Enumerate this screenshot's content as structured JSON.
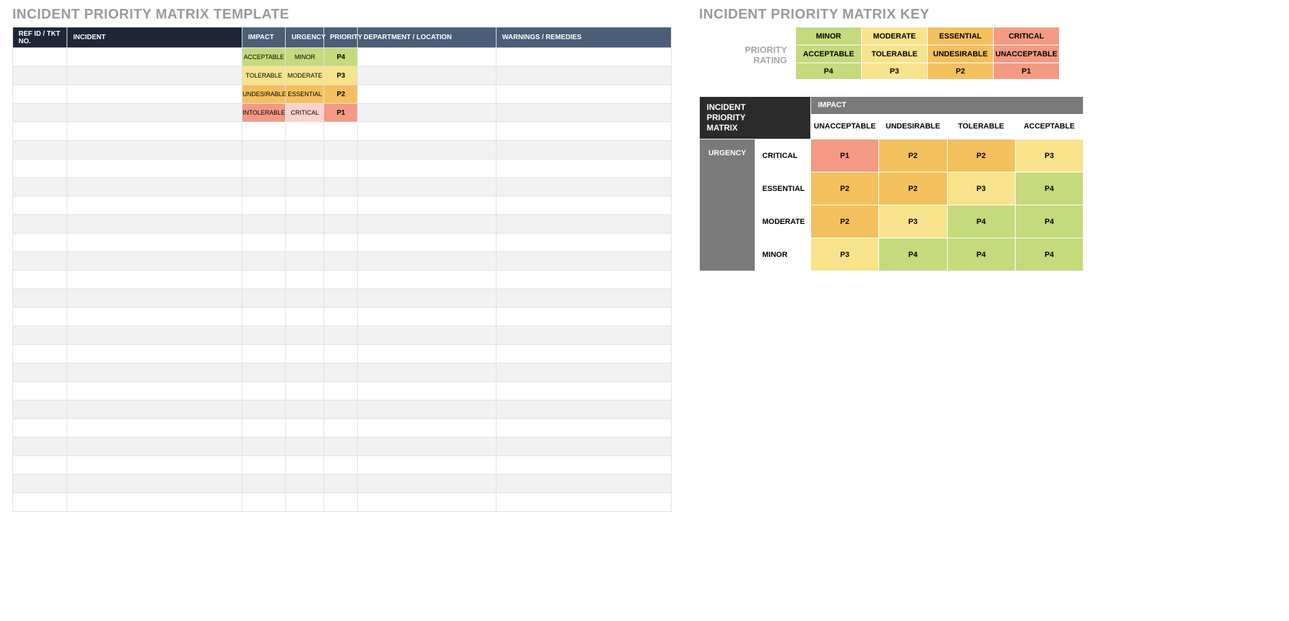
{
  "left": {
    "title": "INCIDENT PRIORITY MATRIX TEMPLATE",
    "headers": {
      "ref": "REF ID / TKT NO.",
      "incident": "INCIDENT",
      "impact": "IMPACT",
      "urgency": "URGENCY",
      "priority": "PRIORITY",
      "dept": "DEPARTMENT / LOCATION",
      "warnings": "WARNINGS / REMEDIES"
    },
    "rows": [
      {
        "impact": "ACCEPTABLE",
        "impact_cls": "c-green",
        "urgency": "MINOR",
        "urgency_cls": "c-green",
        "priority": "P4",
        "priority_cls": "c-green"
      },
      {
        "impact": "TOLERABLE",
        "impact_cls": "c-yellow",
        "urgency": "MODERATE",
        "urgency_cls": "c-yellow",
        "priority": "P3",
        "priority_cls": "c-yellow"
      },
      {
        "impact": "UNDESIRABLE",
        "impact_cls": "c-orange",
        "urgency": "ESSENTIAL",
        "urgency_cls": "c-orange",
        "priority": "P2",
        "priority_cls": "c-orange"
      },
      {
        "impact": "INTOLERABLE",
        "impact_cls": "c-salmon",
        "urgency": "CRITICAL",
        "urgency_cls": "c-lpink",
        "priority": "P1",
        "priority_cls": "c-salmon"
      }
    ],
    "blank_rows_after": 21
  },
  "right": {
    "title": "INCIDENT PRIORITY MATRIX KEY",
    "rating_label_1": "PRIORITY",
    "rating_label_2": "RATING",
    "rating_cols": [
      {
        "name": "MINOR",
        "impact": "ACCEPTABLE",
        "p": "P4",
        "cls": "c-green"
      },
      {
        "name": "MODERATE",
        "impact": "TOLERABLE",
        "p": "P3",
        "cls": "c-yellow"
      },
      {
        "name": "ESSENTIAL",
        "impact": "UNDESIRABLE",
        "p": "P2",
        "cls": "c-orange"
      },
      {
        "name": "CRITICAL",
        "impact": "UNACCEPTABLE",
        "p": "P1",
        "cls": "c-salmon"
      }
    ],
    "matrix": {
      "corner1": "INCIDENT",
      "corner2": "PRIORITY",
      "corner3": "MATRIX",
      "impact_header": "IMPACT",
      "impact_cols": [
        "UNACCEPTABLE",
        "UNDESIRABLE",
        "TOLERABLE",
        "ACCEPTABLE"
      ],
      "urgency_header": "URGENCY",
      "rows": [
        {
          "label": "CRITICAL",
          "cells": [
            {
              "v": "P1",
              "c": "c-salmon"
            },
            {
              "v": "P2",
              "c": "c-orange"
            },
            {
              "v": "P2",
              "c": "c-orange"
            },
            {
              "v": "P3",
              "c": "c-yellow"
            }
          ]
        },
        {
          "label": "ESSENTIAL",
          "cells": [
            {
              "v": "P2",
              "c": "c-orange"
            },
            {
              "v": "P2",
              "c": "c-orange"
            },
            {
              "v": "P3",
              "c": "c-yellow"
            },
            {
              "v": "P4",
              "c": "c-green"
            }
          ]
        },
        {
          "label": "MODERATE",
          "cells": [
            {
              "v": "P2",
              "c": "c-orange"
            },
            {
              "v": "P3",
              "c": "c-yellow"
            },
            {
              "v": "P4",
              "c": "c-green"
            },
            {
              "v": "P4",
              "c": "c-green"
            }
          ]
        },
        {
          "label": "MINOR",
          "cells": [
            {
              "v": "P3",
              "c": "c-yellow"
            },
            {
              "v": "P4",
              "c": "c-green"
            },
            {
              "v": "P4",
              "c": "c-green"
            },
            {
              "v": "P4",
              "c": "c-green"
            }
          ]
        }
      ]
    }
  }
}
